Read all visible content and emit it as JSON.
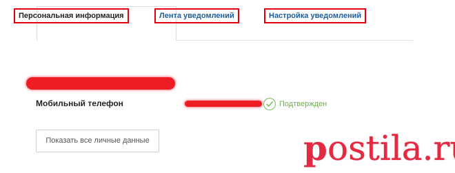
{
  "tabs": [
    {
      "label": "Персональная информация",
      "active": true
    },
    {
      "label": "Лента уведомлений",
      "active": false
    },
    {
      "label": "Настройка уведомлений",
      "active": false
    }
  ],
  "phone": {
    "label": "Мобильный телефон",
    "status": "Подтвержден"
  },
  "show_all_button": "Показать все личные данные",
  "watermark": {
    "first": "p",
    "rest": "ostila.ru"
  },
  "colors": {
    "highlight_border": "#e2000f",
    "link": "#1b5e9c",
    "confirmed_green": "#6fb04d",
    "watermark_red": "#e22b40"
  }
}
